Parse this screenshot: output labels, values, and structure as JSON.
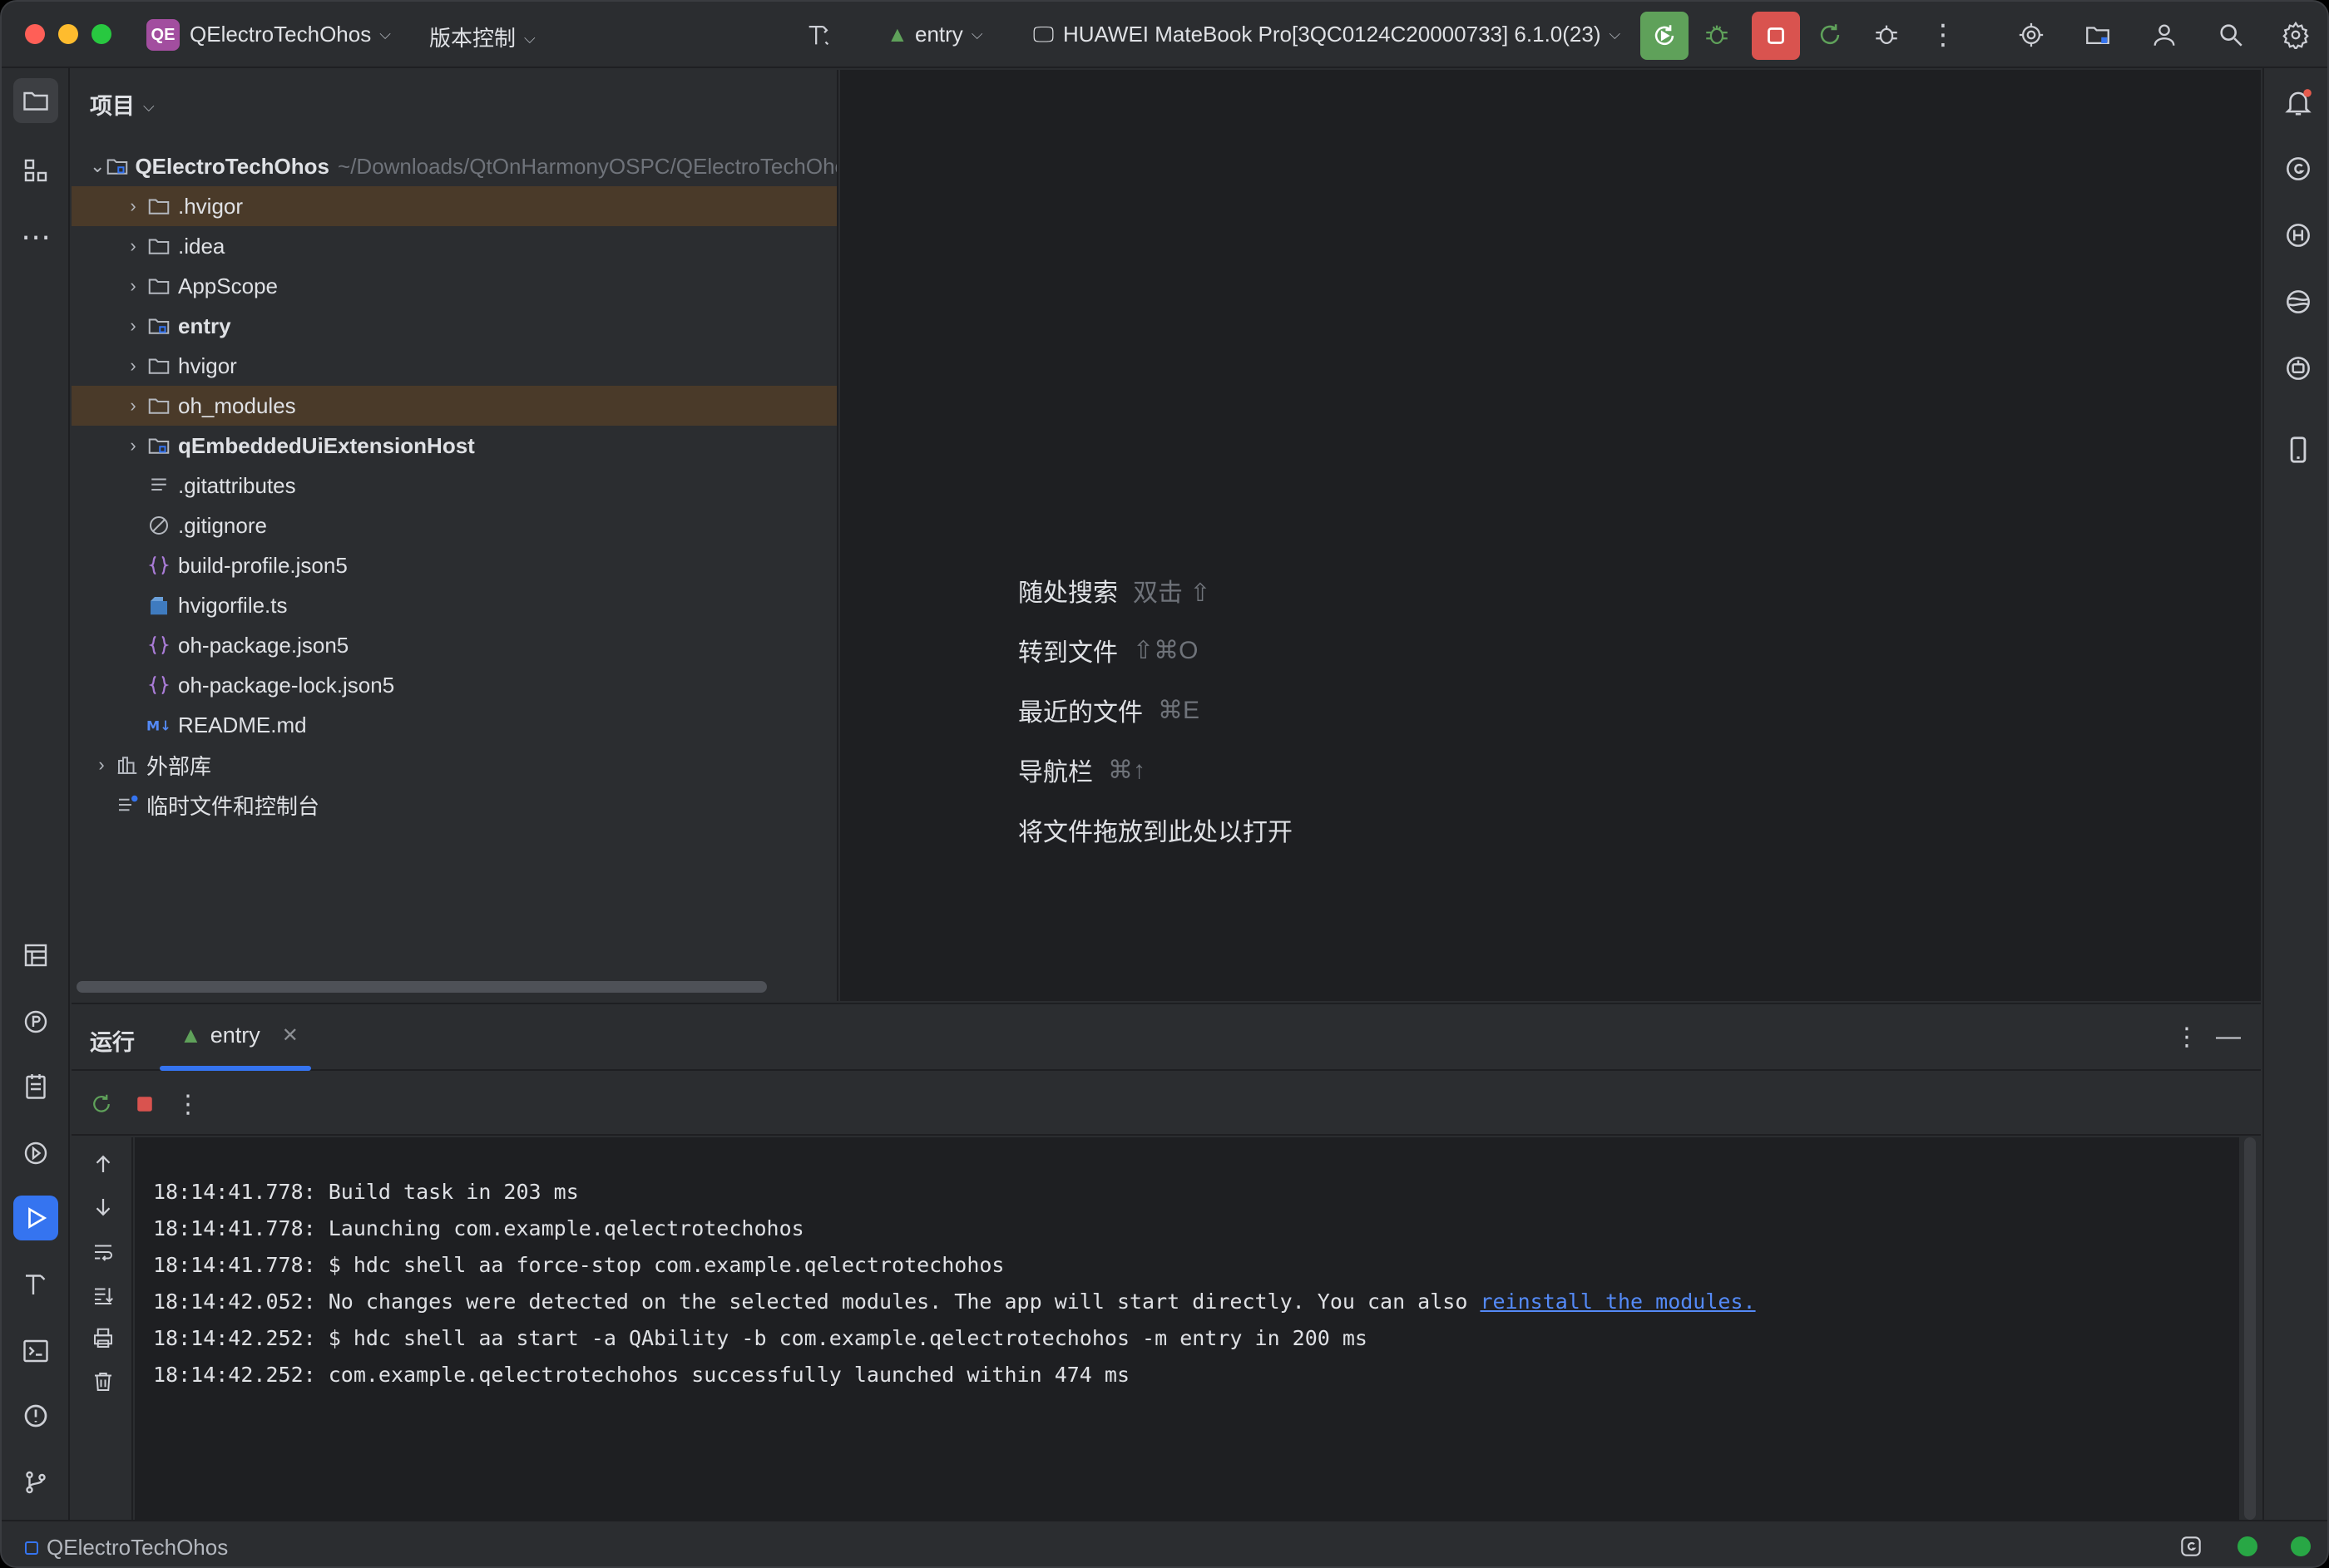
{
  "titlebar": {
    "project_badge": "QE",
    "project_name": "QElectroTechOhos",
    "vcs_label": "版本控制",
    "run_config": "entry",
    "device": "HUAWEI MateBook Pro[3QC0124C20000733] 6.1.0(23)"
  },
  "project_panel": {
    "title": "项目",
    "root": {
      "name": "QElectroTechOhos",
      "path": "~/Downloads/QtOnHarmonyOSPC/QElectroTechOhos"
    },
    "items": [
      {
        "name": ".hvigor",
        "icon": "folder-icon",
        "expandable": true,
        "bold": false,
        "highlight": true
      },
      {
        "name": ".idea",
        "icon": "folder-icon",
        "expandable": true,
        "bold": false,
        "highlight": false
      },
      {
        "name": "AppScope",
        "icon": "folder-icon",
        "expandable": true,
        "bold": false,
        "highlight": false
      },
      {
        "name": "entry",
        "icon": "module-folder-icon",
        "expandable": true,
        "bold": true,
        "highlight": false
      },
      {
        "name": "hvigor",
        "icon": "folder-icon",
        "expandable": true,
        "bold": false,
        "highlight": false
      },
      {
        "name": "oh_modules",
        "icon": "folder-icon",
        "expandable": true,
        "bold": false,
        "highlight": true
      },
      {
        "name": "qEmbeddedUiExtensionHost",
        "icon": "module-folder-icon",
        "expandable": true,
        "bold": true,
        "highlight": false
      },
      {
        "name": ".gitattributes",
        "icon": "text-file-icon",
        "expandable": false,
        "bold": false,
        "highlight": false
      },
      {
        "name": ".gitignore",
        "icon": "ignore-file-icon",
        "expandable": false,
        "bold": false,
        "highlight": false
      },
      {
        "name": "build-profile.json5",
        "icon": "json-file-icon",
        "expandable": false,
        "bold": false,
        "highlight": false
      },
      {
        "name": "hvigorfile.ts",
        "icon": "ts-file-icon",
        "expandable": false,
        "bold": false,
        "highlight": false
      },
      {
        "name": "oh-package.json5",
        "icon": "json-file-icon",
        "expandable": false,
        "bold": false,
        "highlight": false
      },
      {
        "name": "oh-package-lock.json5",
        "icon": "json-file-icon",
        "expandable": false,
        "bold": false,
        "highlight": false
      },
      {
        "name": "README.md",
        "icon": "markdown-file-icon",
        "expandable": false,
        "bold": false,
        "highlight": false
      }
    ],
    "external_libs": "外部库",
    "scratches": "临时文件和控制台"
  },
  "editor_hints": [
    {
      "label": "随处搜索",
      "key": "双击 ⇧"
    },
    {
      "label": "转到文件",
      "key": "⇧⌘O"
    },
    {
      "label": "最近的文件",
      "key": "⌘E"
    },
    {
      "label": "导航栏",
      "key": "⌘↑"
    },
    {
      "label": "将文件拖放到此处以打开",
      "key": ""
    }
  ],
  "run_panel": {
    "title": "运行",
    "tab_label": "entry",
    "console": [
      {
        "text": "18:14:41.778: Build task in 203 ms",
        "link": ""
      },
      {
        "text": "18:14:41.778: Launching com.example.qelectrotechohos",
        "link": ""
      },
      {
        "text": "18:14:41.778: $ hdc shell aa force-stop com.example.qelectrotechohos",
        "link": ""
      },
      {
        "text": "18:14:42.052: No changes were detected on the selected modules. The app will start directly. You can also ",
        "link": "reinstall the modules."
      },
      {
        "text": "18:14:42.252: $ hdc shell aa start -a QAbility -b com.example.qelectrotechohos -m entry in 200 ms",
        "link": ""
      },
      {
        "text": "18:14:42.252: com.example.qelectrotechohos successfully launched within 474 ms",
        "link": ""
      }
    ]
  },
  "statusbar": {
    "project": "QElectroTechOhos"
  },
  "colors": {
    "accent": "#3574f0",
    "highlight_row": "#4a3a29",
    "run_green": "#5fa15a",
    "stop_red": "#d9534f",
    "badge": "#a24e9f"
  }
}
